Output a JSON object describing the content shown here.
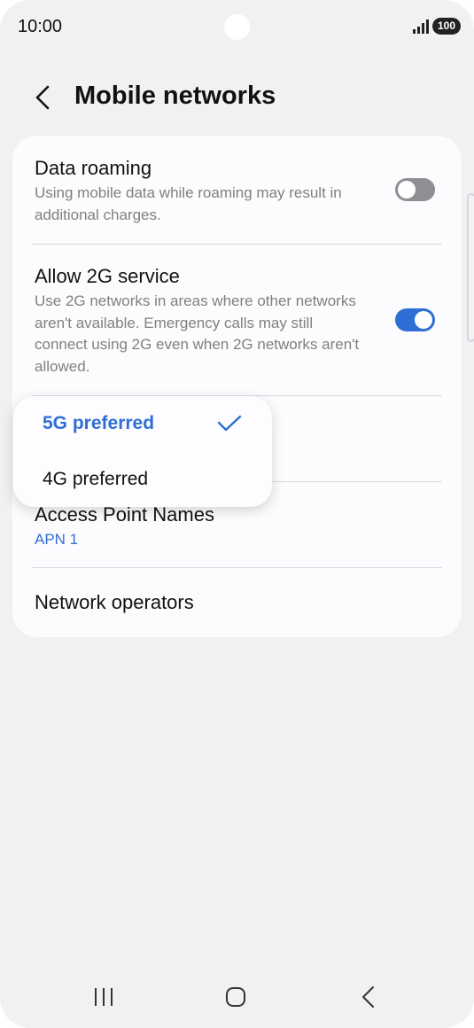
{
  "status_bar": {
    "time": "10:00",
    "battery": "100",
    "signal_icon": "signal-bars-icon"
  },
  "header": {
    "back_icon": "chevron-left-icon",
    "title": "Mobile networks"
  },
  "settings": {
    "data_roaming": {
      "title": "Data roaming",
      "description": "Using mobile data while roaming may result in additional charges.",
      "enabled": false
    },
    "allow_2g": {
      "title": "Allow 2G service",
      "description": "Use 2G networks in areas where other networks aren't available. Emergency calls may still connect using 2G even when 2G networks aren't allowed.",
      "enabled": true
    },
    "access_point_names": {
      "title": "Access Point Names",
      "value": "APN 1"
    },
    "network_operators": {
      "title": "Network operators"
    }
  },
  "network_mode_menu": {
    "options": [
      {
        "label": "5G preferred",
        "selected": true
      },
      {
        "label": "4G preferred",
        "selected": false
      }
    ]
  },
  "nav_bar": {
    "recents_icon": "recents-icon",
    "home_icon": "home-icon",
    "back_icon": "back-icon"
  },
  "colors": {
    "accent": "#2f6ed6",
    "background": "#f1f1f3",
    "card": "#fcfcfe",
    "toggle_off": "#8f8f93"
  }
}
